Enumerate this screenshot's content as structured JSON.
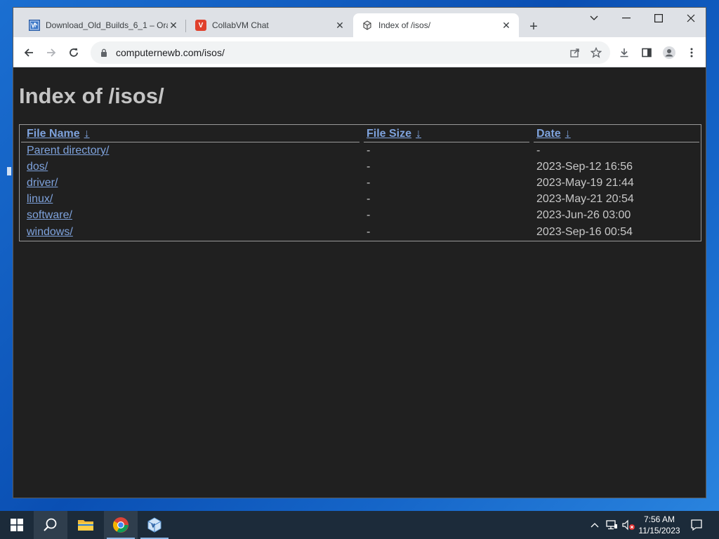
{
  "browser": {
    "tabs": [
      {
        "title": "Download_Old_Builds_6_1 – Ora",
        "favicon": "virtualbox-page-icon",
        "active": false
      },
      {
        "title": "CollabVM Chat",
        "favicon": "collabvm-icon",
        "active": false
      },
      {
        "title": "Index of /isos/",
        "favicon": "server-icon",
        "active": true
      }
    ],
    "url": "computernewb.com/isos/"
  },
  "page": {
    "heading": "Index of /isos/",
    "columns": {
      "name": "File Name",
      "size": "File Size",
      "date": "Date",
      "sort_arrow": "↓"
    },
    "rows": [
      {
        "name": "Parent directory/",
        "size": "-",
        "date": "-"
      },
      {
        "name": "dos/",
        "size": "-",
        "date": "2023-Sep-12 16:56"
      },
      {
        "name": "driver/",
        "size": "-",
        "date": "2023-May-19 21:44"
      },
      {
        "name": "linux/",
        "size": "-",
        "date": "2023-May-21 20:54"
      },
      {
        "name": "software/",
        "size": "-",
        "date": "2023-Jun-26 03:00"
      },
      {
        "name": "windows/",
        "size": "-",
        "date": "2023-Sep-16 00:54"
      }
    ]
  },
  "taskbar": {
    "time": "7:56 AM",
    "date": "11/15/2023"
  },
  "colors": {
    "page_bg": "#202020",
    "link": "#7ea2dc",
    "heading": "#c4c4c4"
  }
}
